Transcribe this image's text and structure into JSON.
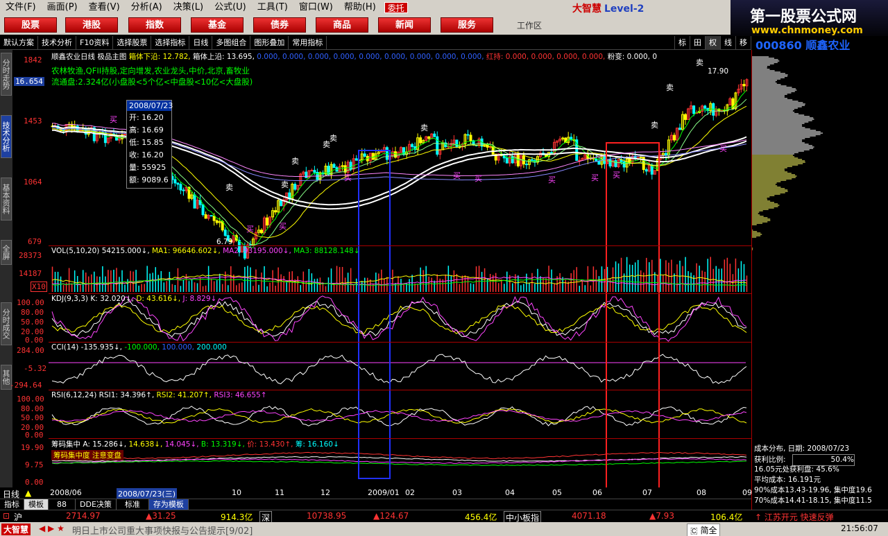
{
  "menu": [
    "文件(F)",
    "画面(P)",
    "查看(V)",
    "分析(A)",
    "决策(L)",
    "公式(U)",
    "工具(T)",
    "窗口(W)",
    "帮助(H)"
  ],
  "entrust": "委托",
  "brand": {
    "name": "大智慧",
    "level": "Level-2"
  },
  "site": {
    "title": "第一股票公式网",
    "url": "www.chnmoney.com"
  },
  "tabs": [
    "股票",
    "港股",
    "指数",
    "基金",
    "债券",
    "商品",
    "新闻",
    "服务"
  ],
  "workarea": "工作区",
  "toolbar": [
    "默认方案",
    "技术分析",
    "F10资料",
    "选择股票",
    "选择指标",
    "日线",
    "多图组合",
    "图形叠加",
    "常用指标"
  ],
  "toolbar_right": [
    "标",
    "田",
    "权",
    "线",
    "移"
  ],
  "stock": {
    "code": "000860",
    "name": "顺鑫农业"
  },
  "left_tabs": [
    "分时走势",
    "技术分析",
    "基本资料",
    "全屏",
    "分时成交",
    "其他"
  ],
  "main_title": {
    "name": "顺鑫农业日线",
    "main": "极品主图",
    "box_low": "箱体下沿: 12.782,",
    "box_high": "箱体上沿: 13.695,",
    "zeros": "0.000, 0.000, 0.000, 0.000, 0.000, 0.000, 0.000, 0.000, 0.000,",
    "red": "红持: 0.000, 0.000, 0.000, 0.000,",
    "powder": "粉变: 0.000, 0"
  },
  "concepts": "农林牧渔,QFII持股,定向增发,农业龙头,中价,北京,畜牧业",
  "float": "流通盘:2.324亿(小盘股<5个亿<中盘股<10亿<大盘股)",
  "price_axis": [
    "1842",
    "16.654",
    "1453",
    "1064",
    "679"
  ],
  "high_label": "17.90",
  "low_label": "6.79",
  "tooltip": {
    "date": "2008/07/23",
    "rows": [
      "开: 16.20",
      "高: 16.69",
      "低: 15.85",
      "收: 16.20",
      "量: 55925",
      "额: 9089.6"
    ]
  },
  "vol": {
    "title": "VOL(5,10,20)",
    "v": "54215.000↓,",
    "ma1": "MA1: 96646.602↓,",
    "ma2": "MA2: 93195.000↓,",
    "ma3": "MA3: 88128.148↓",
    "axis": [
      "28373",
      "14187",
      "X10"
    ]
  },
  "kdj": {
    "title": "KDJ(9,3,3)",
    "k": "K: 32.020↓,",
    "d": "D: 43.616↓,",
    "j": "J: 8.829↓",
    "axis": [
      "100.00",
      "80.00",
      "50.00",
      "20.00",
      "0.00"
    ]
  },
  "cci": {
    "title": "CCI(14)",
    "v": "-135.935↓,",
    "p": "-100.000,",
    "q": "100.000,",
    "r": "200.000",
    "axis": [
      "284.00",
      "-5.32",
      "-294.64"
    ]
  },
  "rsi": {
    "title": "RSI(6,12,24)",
    "r1": "RSI1: 34.396↑,",
    "r2": "RSI2: 41.207↑,",
    "r3": "RSI3: 46.655↑",
    "axis": [
      "100.00",
      "80.00",
      "50.00",
      "20.00",
      "0.00"
    ]
  },
  "chip": {
    "title": "筹码集中",
    "a": "A: 15.286↓,",
    "b1": "14.638↓,",
    "b2": "14.045↓,",
    "b3": "B: 13.319↓,",
    "price": "价: 13.430↑,",
    "chou": "筹: 16.160↓",
    "axis": [
      "19.90",
      "9.75",
      "0.00"
    ],
    "legend": "筹码集中度  注意变盘"
  },
  "xaxis": {
    "label": "日线",
    "dates": [
      "2008/06",
      "2008/07/23(三)",
      "10",
      "11",
      "12",
      "2009/01",
      "02",
      "03",
      "04",
      "05",
      "06",
      "07",
      "08",
      "09"
    ]
  },
  "bottom_tabs": [
    "指标",
    "模板",
    "88",
    "DDE决策",
    "标准",
    "存为模板"
  ],
  "cost": {
    "title": "成本分布, 日期: 2008/07/23",
    "profit_label": "获利比例:",
    "profit_value": "50.4%",
    "r1": "16.05元处获利盘: 45.6%",
    "r2": "平均成本: 16.191元",
    "r3": "90%成本13.43-19.96, 集中度19.6",
    "r4": "70%成本14.41-18.15, 集中度11.5"
  },
  "status": {
    "sh": "沪",
    "sh_idx": "2714.97",
    "sh_chg": "▲31.25",
    "sh_amt": "914.3亿",
    "sz": "深",
    "sz_idx": "10738.95",
    "sz_chg": "▲124.67",
    "sz_amt": "456.4亿",
    "zx": "中小板指",
    "zx_idx": "4071.18",
    "zx_chg": "▲7.93",
    "zx_amt": "106.4亿",
    "news": "↑ 江苏开元 快速反弹"
  },
  "marquee": {
    "app": "大智慧",
    "text": "明日上市公司重大事项快报与公告提示[9/02]",
    "ime": "简全",
    "time": "21:56:07"
  },
  "marks": {
    "buy": "买",
    "sell": "卖"
  }
}
